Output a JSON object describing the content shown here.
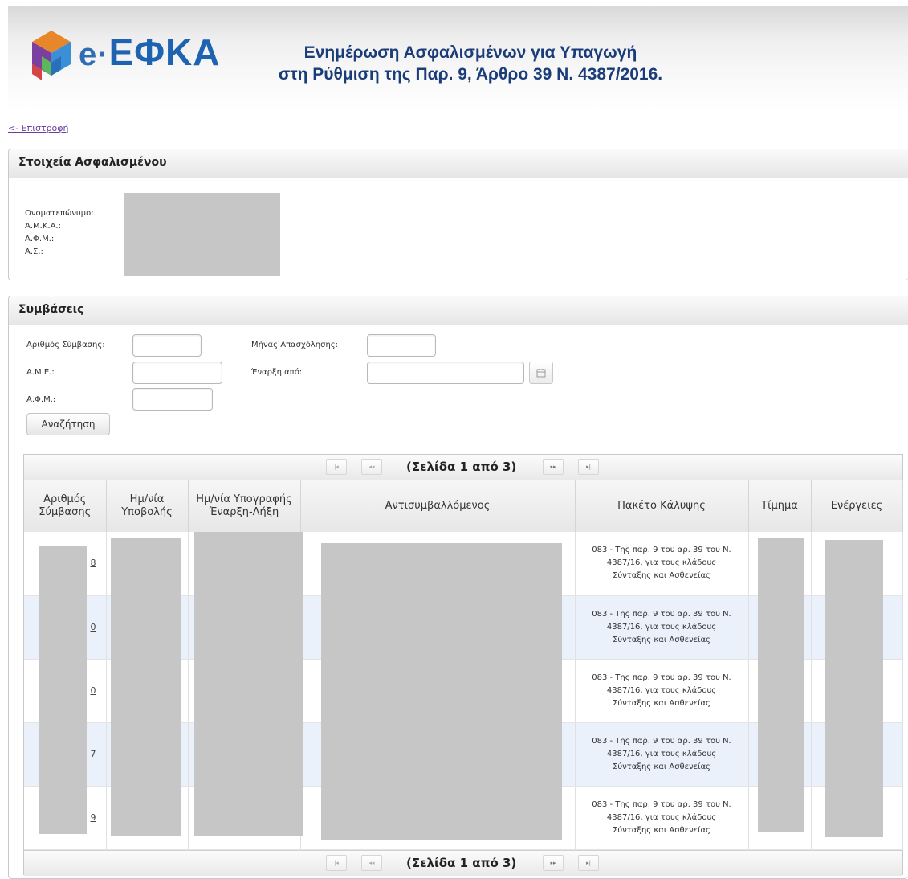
{
  "header": {
    "logo_prefix": "e·",
    "logo_main": "ΕΦΚΑ",
    "title_line1": "Ενημέρωση Ασφαλισμένων για Υπαγωγή",
    "title_line2": "στη Ρύθμιση της Παρ. 9, Άρθρο 39 Ν. 4387/2016.",
    "colors": {
      "title": "#1a3d7a",
      "logo": "#1d63b1"
    }
  },
  "back_link": "<- Επιστροφή",
  "insured": {
    "title": "Στοιχεία Ασφαλισμένου",
    "labels": [
      "Ονοματεπώνυμο:",
      "Α.Μ.Κ.Α.:",
      "Α.Φ.Μ.:",
      "Α.Σ.:"
    ]
  },
  "contracts": {
    "title": "Συμβάσεις",
    "form": {
      "contract_number_label": "Αριθμός Σύμβασης:",
      "employment_month_label": "Μήνας Απασχόλησης:",
      "ame_label": "Α.Μ.Ε.:",
      "start_from_label": "Έναρξη από:",
      "afm_label": "Α.Φ.Μ.:",
      "search_button": "Αναζήτηση"
    },
    "pager": {
      "info": "(Σελίδα 1 από 3)"
    },
    "columns": [
      "Αριθμός Σύμβασης",
      "Ημ/νία Υποβολής",
      "Ημ/νία Υπογραφής Έναρξη-Λήξη",
      "Αντισυμβαλλόμενος",
      "Πακέτο Κάλυψης",
      "Τίμημα",
      "Ενέργειες"
    ],
    "rows": [
      {
        "num_tail": "8",
        "package": "083 - Της παρ. 9 του αρ. 39 του Ν. 4387/16, για τους κλάδους Σύνταξης και Ασθενείας"
      },
      {
        "num_tail": "0",
        "package": "083 - Της παρ. 9 του αρ. 39 του Ν. 4387/16, για τους κλάδους Σύνταξης και Ασθενείας"
      },
      {
        "num_tail": "0",
        "package": "083 - Της παρ. 9 του αρ. 39 του Ν. 4387/16, για τους κλάδους Σύνταξης και Ασθενείας"
      },
      {
        "num_tail": "7",
        "package": "083 - Της παρ. 9 του αρ. 39 του Ν. 4387/16, για τους κλάδους Σύνταξης και Ασθενείας"
      },
      {
        "num_tail": "9",
        "package": "083 - Της παρ. 9 του αρ. 39 του Ν. 4387/16, για τους κλάδους Σύνταξης και Ασθενείας"
      }
    ]
  }
}
